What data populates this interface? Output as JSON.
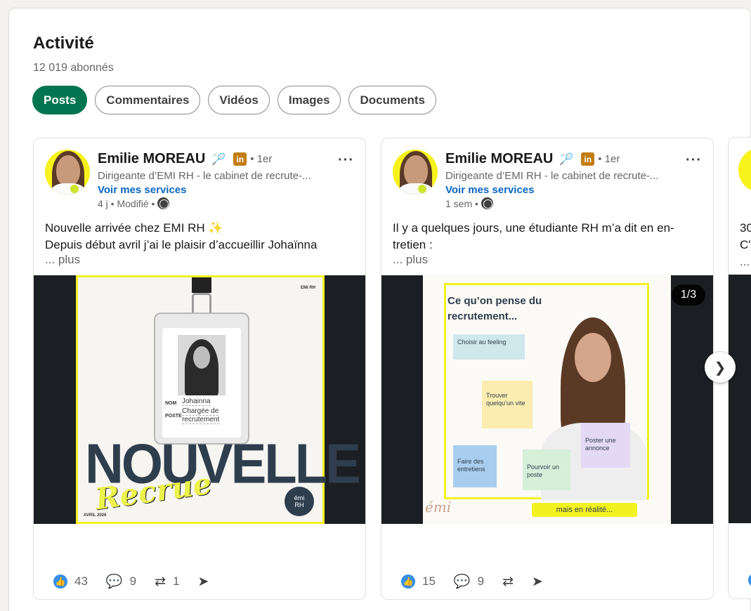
{
  "section": {
    "title": "Activité",
    "followers": "12 019 abonnés"
  },
  "filters": [
    "Posts",
    "Commentaires",
    "Vidéos",
    "Images",
    "Documents"
  ],
  "posts": [
    {
      "author": "Emilie MOREAU",
      "degree": "• 1er",
      "headline": "Dirigeante d’EMI RH - le cabinet de recrute-...",
      "services": "Voir mes services",
      "time": "4 j • Modifié •",
      "text_line1": "Nouvelle arrivée chez EMI RH ✨",
      "text_line2": "Depuis début avril j’ai le plaisir d’accueillir Johaïnna",
      "more": "... plus",
      "media": {
        "top_label": "EMI RH",
        "nom_label": "NOM",
        "nom_value": "Johainna",
        "poste_label": "POSTE",
        "poste_value1": "Chargée de",
        "poste_value2": "recrutement",
        "headline_big": "NOUVELLE",
        "headline_script": "Recrue",
        "date": "AVRIL 2026",
        "logo_line1": "émi",
        "logo_line2": "RH"
      },
      "likes": "43",
      "comments": "9",
      "reposts": "1"
    },
    {
      "author": "Emilie MOREAU",
      "degree": "• 1er",
      "headline": "Dirigeante d’EMI RH - le cabinet de recrute-...",
      "services": "Voir mes services",
      "time": "1 sem •",
      "text_line1": "Il y a quelques jours, une étudiante RH m’a dit en en-",
      "text_line2": "tretien :",
      "more": "... plus",
      "media": {
        "title": "Ce qu’on pense du recrutement...",
        "note1": "Choisir au feeling",
        "note2": "Trouver quelqu’un vite",
        "note3": "Poster une annonce",
        "note4": "Faire des entretiens",
        "note5": "Pourvoir un poste",
        "bottom": "mais en réalité...",
        "brand": "émi"
      },
      "counter": "1/3",
      "likes": "15",
      "comments": "9"
    }
  ],
  "partial_card": {
    "line1": "30",
    "line2": "C'",
    "line3": "..."
  },
  "colors": {
    "active_chip": "#01754f",
    "link": "#0a66c2",
    "accent_yellow": "#f2f221"
  }
}
